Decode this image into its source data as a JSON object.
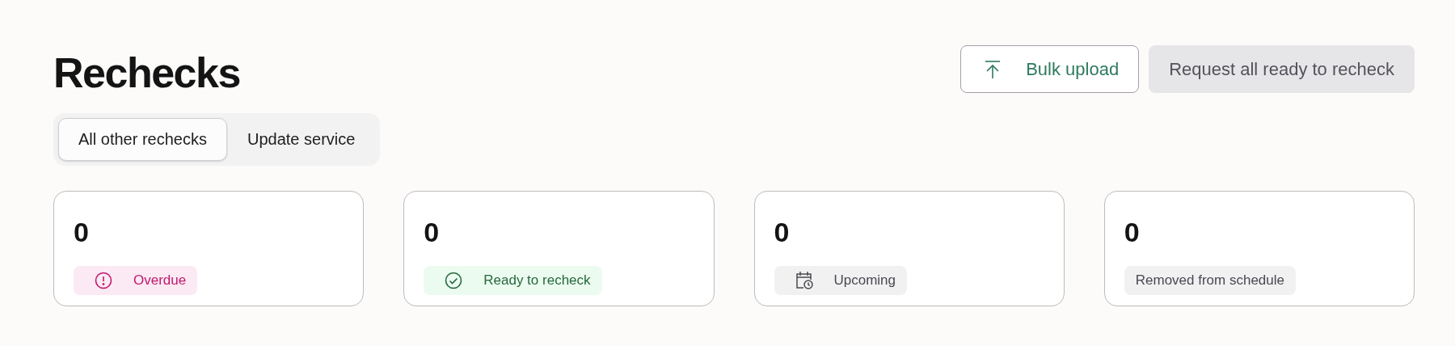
{
  "title": "Rechecks",
  "actions": [
    {
      "label": "Bulk upload",
      "kind": "upload"
    },
    {
      "label": "Request all ready to recheck",
      "kind": "disabled"
    }
  ],
  "tabs": [
    {
      "label": "All other rechecks",
      "selected": true
    },
    {
      "label": "Update service",
      "selected": false
    }
  ],
  "cards": [
    {
      "count": "0",
      "status": "Overdue",
      "kind": "overdue"
    },
    {
      "count": "0",
      "status": "Ready to recheck",
      "kind": "ready"
    },
    {
      "count": "0",
      "status": "Upcoming",
      "kind": "upcoming"
    },
    {
      "count": "0",
      "status": "Removed from schedule",
      "kind": "removed"
    }
  ]
}
